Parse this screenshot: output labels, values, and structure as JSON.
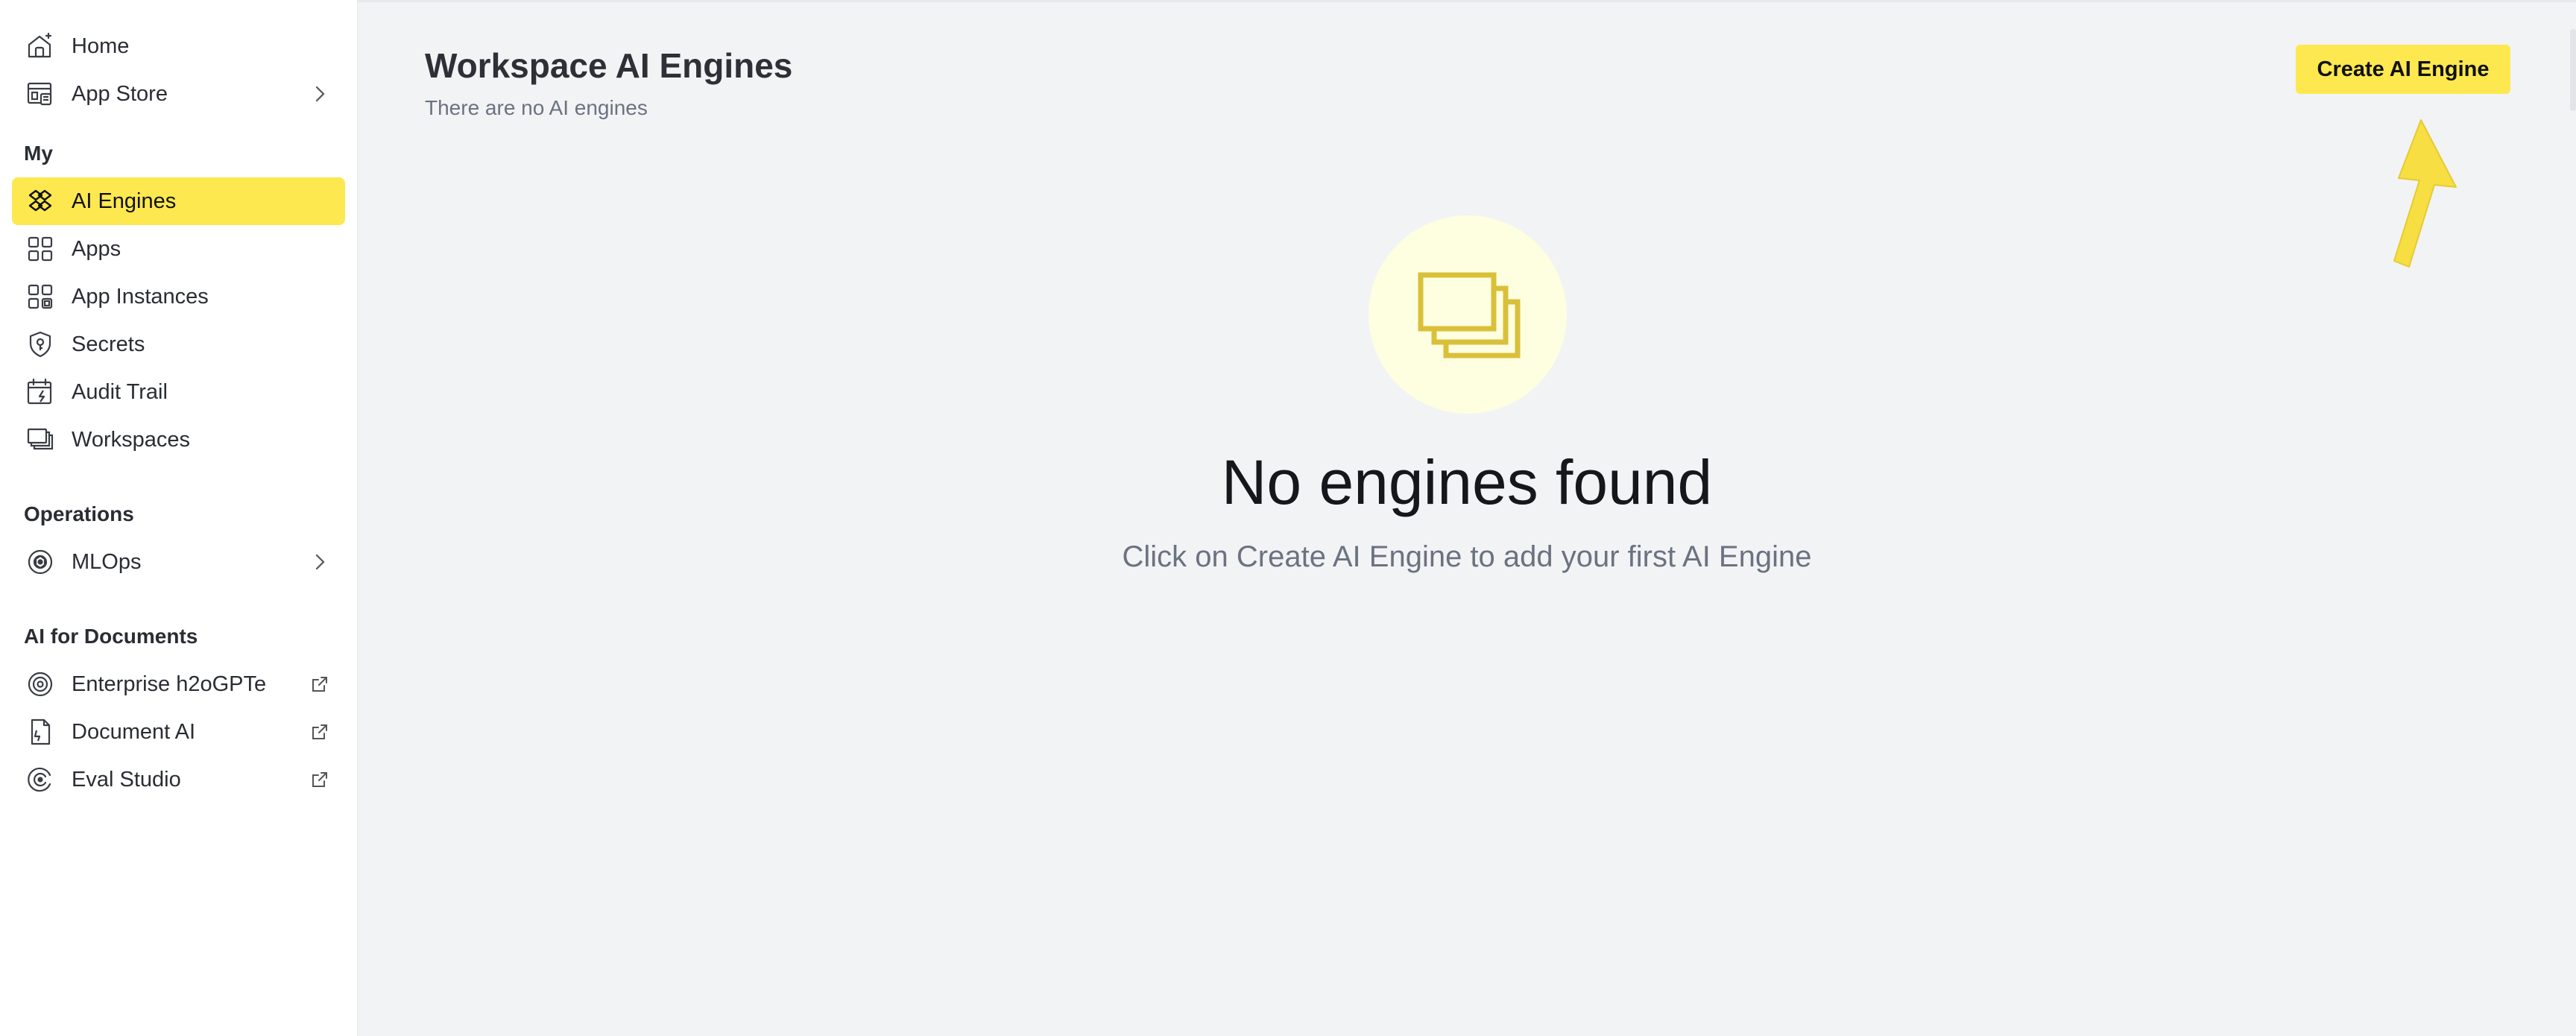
{
  "sidebar": {
    "top_items": [
      {
        "label": "Home",
        "icon": "home-icon"
      },
      {
        "label": "App Store",
        "icon": "app-store-icon"
      }
    ],
    "sections": [
      {
        "title": "My",
        "items": [
          {
            "label": "AI Engines",
            "icon": "ai-engines-icon",
            "active": true
          },
          {
            "label": "Apps",
            "icon": "apps-icon"
          },
          {
            "label": "App Instances",
            "icon": "app-instances-icon"
          },
          {
            "label": "Secrets",
            "icon": "secrets-icon"
          },
          {
            "label": "Audit Trail",
            "icon": "audit-trail-icon"
          },
          {
            "label": "Workspaces",
            "icon": "workspaces-icon"
          }
        ]
      },
      {
        "title": "Operations",
        "items": [
          {
            "label": "MLOps",
            "icon": "mlops-icon"
          }
        ]
      },
      {
        "title": "AI for Documents",
        "items": [
          {
            "label": "Enterprise h2oGPTe",
            "icon": "h2ogpte-icon"
          },
          {
            "label": "Document AI",
            "icon": "document-ai-icon"
          },
          {
            "label": "Eval Studio",
            "icon": "eval-studio-icon"
          }
        ]
      }
    ]
  },
  "header": {
    "title": "Workspace AI Engines",
    "subtitle": "There are no AI engines",
    "create_button": "Create AI Engine"
  },
  "empty_state": {
    "icon": "stacked-windows-icon",
    "title": "No engines found",
    "message": "Click on Create AI Engine to add your first AI Engine"
  },
  "colors": {
    "accent": "#fde84f",
    "empty_circle": "#fefee0",
    "empty_icon": "#d9c03a"
  }
}
